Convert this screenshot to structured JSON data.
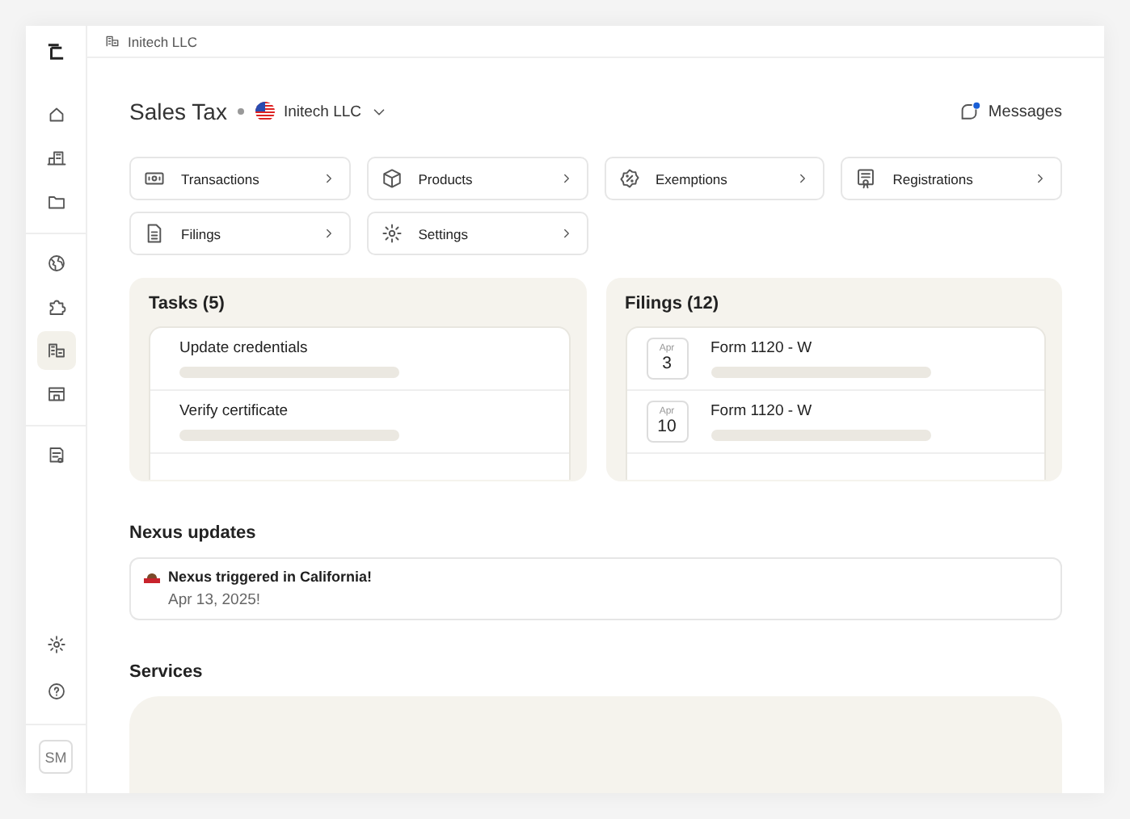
{
  "topbar": {
    "breadcrumb": "Initech LLC"
  },
  "sidebar": {
    "groups": [
      [
        {
          "selected": false
        },
        {
          "selected": false
        },
        {
          "selected": false
        }
      ],
      [
        {
          "selected": false
        },
        {
          "selected": false
        },
        {
          "selected": true
        },
        {
          "selected": false
        }
      ],
      [
        {
          "selected": false
        }
      ]
    ],
    "bottom": [
      {
        "selected": false
      },
      {
        "selected": false
      }
    ],
    "avatar": "SM"
  },
  "header": {
    "title": "Sales Tax",
    "company": "Initech LLC",
    "messages": "Messages",
    "messages_unread": true
  },
  "shortcuts": [
    {
      "label": "Transactions"
    },
    {
      "label": "Products"
    },
    {
      "label": "Exemptions"
    },
    {
      "label": "Registrations"
    },
    {
      "label": "Filings"
    },
    {
      "label": "Settings"
    }
  ],
  "tasks": {
    "title": "Tasks (5)",
    "items": [
      {
        "label": "Update credentials"
      },
      {
        "label": "Verify certificate"
      }
    ]
  },
  "filings": {
    "title": "Filings (12)",
    "items": [
      {
        "month": "Apr",
        "day": "3",
        "label": "Form 1120 - W"
      },
      {
        "month": "Apr",
        "day": "10",
        "label": "Form 1120 - W"
      }
    ]
  },
  "nexus": {
    "title": "Nexus updates",
    "items": [
      {
        "title": "Nexus triggered in California!",
        "date": "Apr 13, 2025!"
      }
    ]
  },
  "services": {
    "title": "Services"
  }
}
